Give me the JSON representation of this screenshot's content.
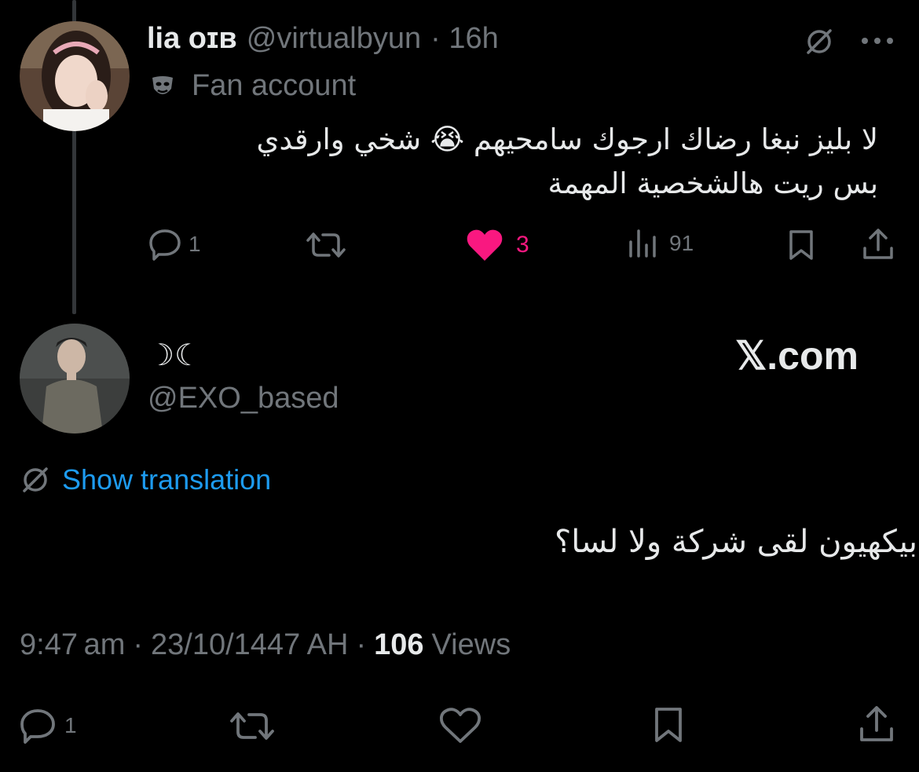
{
  "reply_tweet": {
    "display_name": "lia ᴏɪʙ",
    "handle": "@virtualbyun",
    "time": "· 16h",
    "label": "Fan account",
    "text_line1": "لا بليز نبغا رضاك ارجوك سامحيهم 😭 شخي وارقدي",
    "text_line2": "بس ريت هالشخصية المهمة",
    "replies": "1",
    "likes": "3",
    "views": "91"
  },
  "main_tweet": {
    "display_name": "☽☾",
    "handle": "@EXO_based",
    "watermark": "𝕏.com",
    "show_translation": "Show translation",
    "text": "بيكهيون لقى شركة ولا لسا؟",
    "time": "9:47 am",
    "sep1": "·",
    "date": "23/10/1447 AH",
    "sep2": "·",
    "views_count": "106",
    "views_label": "Views",
    "replies": "1"
  },
  "colors": {
    "background": "#000000",
    "text": "#e7e9ea",
    "muted": "#71767b",
    "like_pink": "#f91880",
    "link_blue": "#1d9bf0"
  },
  "icons": [
    "grok-icon",
    "more-icon",
    "fan-mask-icon",
    "reply-icon",
    "retweet-icon",
    "like-icon",
    "views-icon",
    "bookmark-icon",
    "share-icon",
    "translate-icon"
  ]
}
